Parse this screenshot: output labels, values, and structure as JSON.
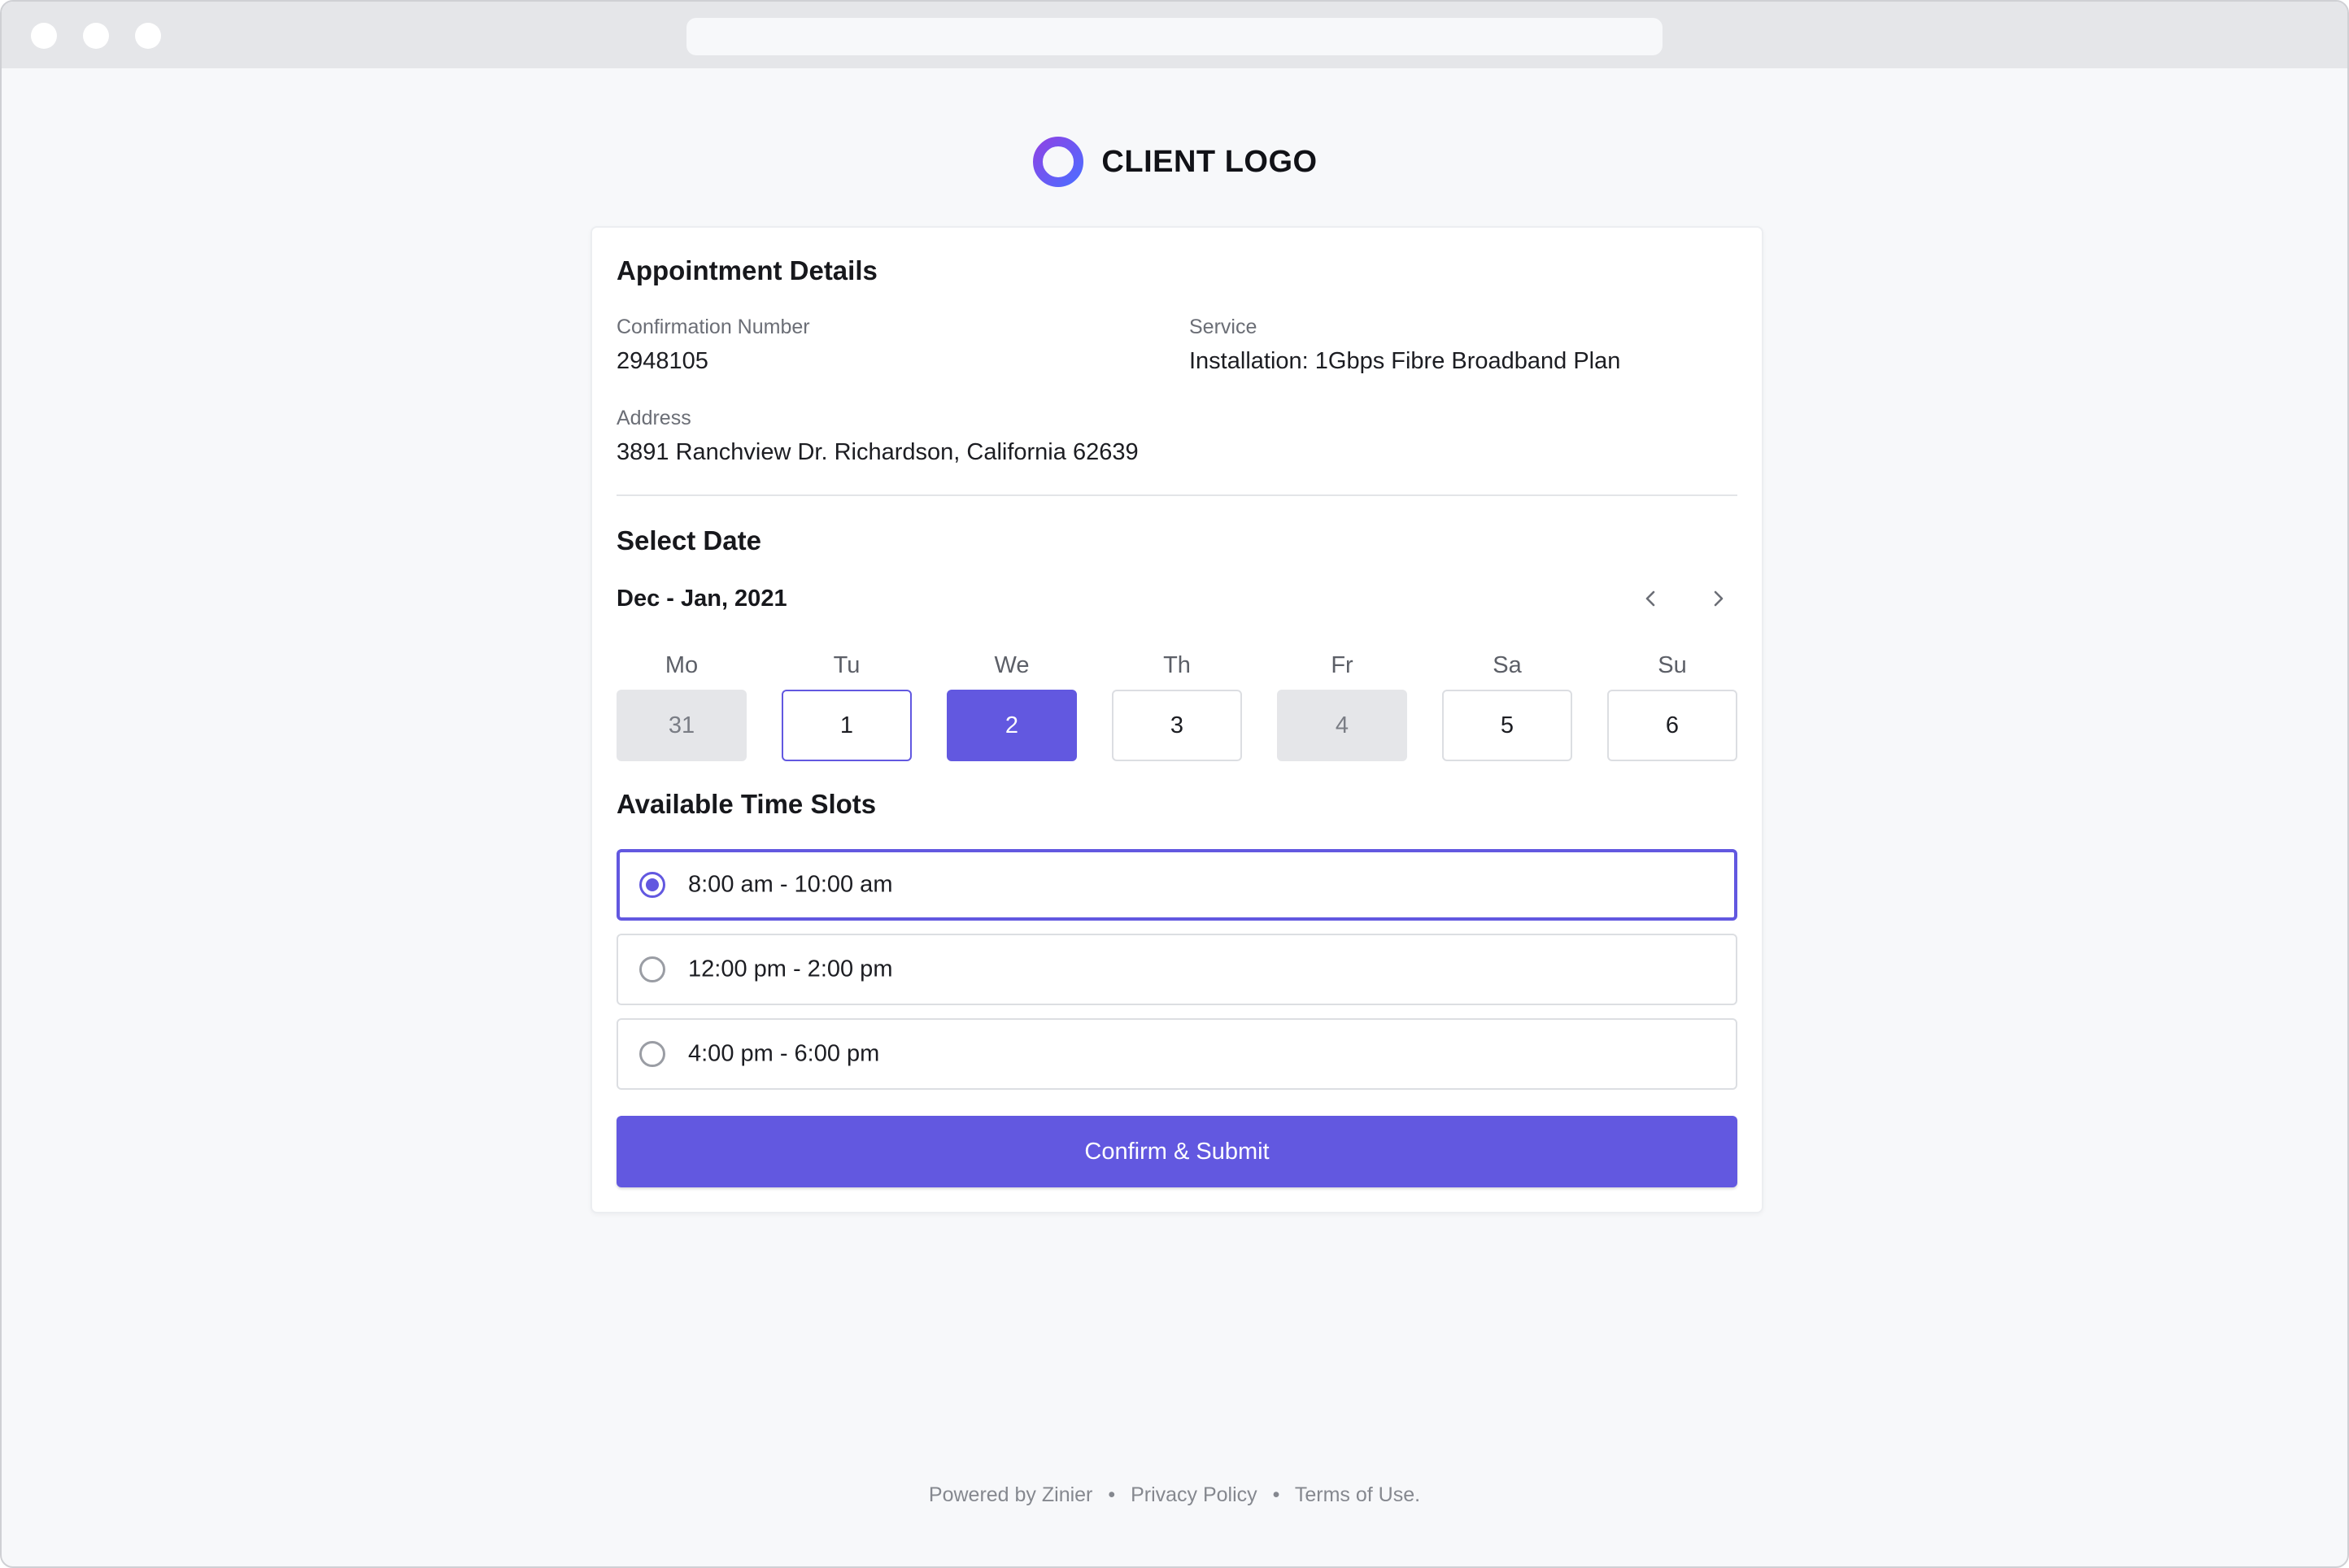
{
  "brand": {
    "name": "CLIENT LOGO",
    "ring_color_start": "#8b45e6",
    "ring_color_end": "#4f6bff"
  },
  "details": {
    "heading": "Appointment Details",
    "confirmation_label": "Confirmation Number",
    "confirmation_value": "2948105",
    "service_label": "Service",
    "service_value": "Installation: 1Gbps Fibre Broadband Plan",
    "address_label": "Address",
    "address_value": "3891 Ranchview Dr. Richardson, California 62639"
  },
  "date_picker": {
    "heading": "Select Date",
    "range": "Dec - Jan, 2021",
    "prev_icon": "chevron-left-icon",
    "next_icon": "chevron-right-icon",
    "days": [
      {
        "weekday": "Mo",
        "date": "31",
        "state": "disabled"
      },
      {
        "weekday": "Tu",
        "date": "1",
        "state": "today"
      },
      {
        "weekday": "We",
        "date": "2",
        "state": "selected"
      },
      {
        "weekday": "Th",
        "date": "3",
        "state": "normal"
      },
      {
        "weekday": "Fr",
        "date": "4",
        "state": "disabled"
      },
      {
        "weekday": "Sa",
        "date": "5",
        "state": "normal"
      },
      {
        "weekday": "Su",
        "date": "6",
        "state": "normal"
      }
    ]
  },
  "time_slots": {
    "heading": "Available Time Slots",
    "slots": [
      {
        "label": "8:00 am - 10:00 am",
        "selected": true
      },
      {
        "label": "12:00 pm - 2:00 pm",
        "selected": false
      },
      {
        "label": "4:00 pm - 6:00 pm",
        "selected": false
      }
    ]
  },
  "submit_label": "Confirm & Submit",
  "footer": {
    "powered_by": "Powered by Zinier",
    "privacy": "Privacy Policy",
    "terms": "Terms of Use.",
    "separator": "•"
  },
  "colors": {
    "accent": "#6258e0",
    "disabled_bg": "#e5e6e9",
    "page_bg": "#f7f8fa"
  }
}
